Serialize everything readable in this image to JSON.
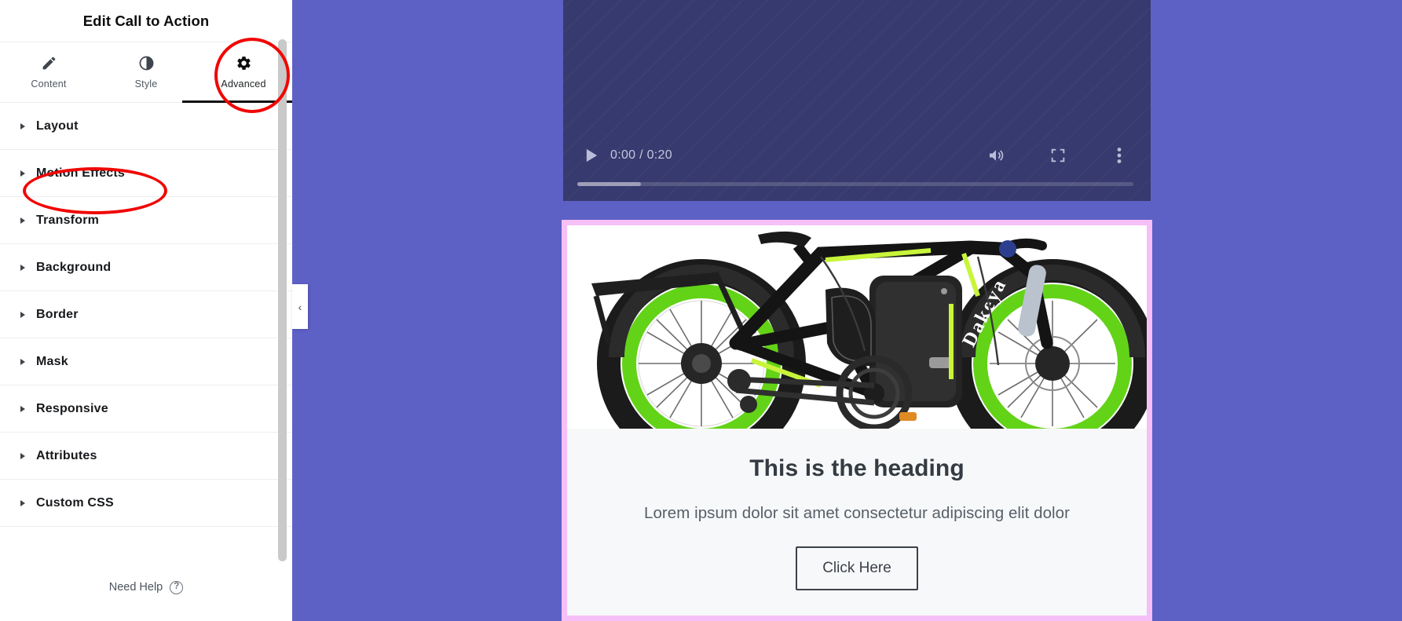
{
  "panel": {
    "title": "Edit Call to Action",
    "tabs": [
      {
        "label": "Content",
        "icon": "pencil-icon",
        "active": false
      },
      {
        "label": "Style",
        "icon": "contrast-icon",
        "active": false
      },
      {
        "label": "Advanced",
        "icon": "gear-icon",
        "active": true
      }
    ],
    "sections": [
      {
        "label": "Layout"
      },
      {
        "label": "Motion Effects"
      },
      {
        "label": "Transform"
      },
      {
        "label": "Background"
      },
      {
        "label": "Border"
      },
      {
        "label": "Mask"
      },
      {
        "label": "Responsive"
      },
      {
        "label": "Attributes"
      },
      {
        "label": "Custom CSS"
      }
    ],
    "footer": {
      "help_label": "Need Help",
      "help_icon": "question-circle-icon"
    },
    "collapse_handle_icon": "chevron-left-icon"
  },
  "annotations": [
    {
      "target": "Advanced",
      "shape": "ellipse",
      "color": "#f00703"
    },
    {
      "target": "Motion Effects",
      "shape": "ellipse",
      "color": "#f00703"
    }
  ],
  "canvas": {
    "background_color": "#5d61c5",
    "video": {
      "play_icon": "play-icon",
      "time": "0:00 / 0:20",
      "current_time": "0:00",
      "duration": "0:20",
      "volume_icon": "volume-icon",
      "fullscreen_icon": "fullscreen-icon",
      "more_icon": "kebab-menu-icon",
      "buffered_percent": "11.5",
      "background_color": "#373a6e"
    },
    "card": {
      "border_color": "#f6bff7",
      "background_color": "#f7f8f9",
      "image_alt": "electric fat-tire bicycle with green rims, brand Dakeya",
      "image_brand_text": "Dakeya",
      "heading": "This is the heading",
      "description": "Lorem ipsum dolor sit amet consectetur adipiscing elit dolor",
      "button_label": "Click Here"
    }
  }
}
